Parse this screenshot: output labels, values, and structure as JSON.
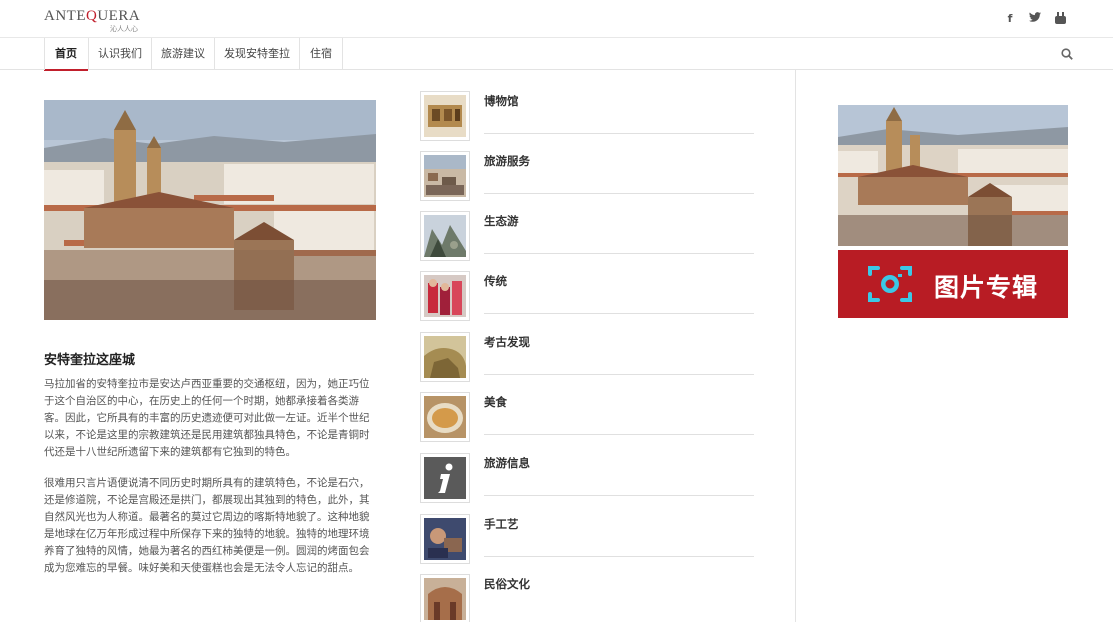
{
  "header": {
    "logo_main_a": "ANTE",
    "logo_main_q": "Q",
    "logo_main_b": "UERA",
    "logo_sub": "沁人人心",
    "social": [
      {
        "icon": "facebook-icon",
        "glyph": "f"
      },
      {
        "icon": "twitter-icon",
        "glyph": "t"
      },
      {
        "icon": "youtube-icon",
        "glyph": "▶"
      }
    ]
  },
  "nav": {
    "items": [
      {
        "label": "首页",
        "active": true
      },
      {
        "label": "认识我们"
      },
      {
        "label": "旅游建议"
      },
      {
        "label": "发现安特奎拉"
      },
      {
        "label": "住宿"
      }
    ]
  },
  "article": {
    "title": "安特奎拉这座城",
    "paragraph1": "马拉加省的安特奎拉市是安达卢西亚重要的交通枢纽，因为，她正巧位于这个自治区的中心，在历史上的任何一个时期，她都承接着各类游客。因此，它所具有的丰富的历史遗迹便可对此做一左证。近半个世纪以来，不论是这里的宗教建筑还是民用建筑都独具特色，不论是青铜时代还是十八世纪所遗留下来的建筑都有它独到的特色。",
    "paragraph2": "很难用只言片语便说清不同历史时期所具有的建筑特色，不论是石穴，还是修道院，不论是宫殿还是拱门，都展现出其独到的特色，此外，其自然风光也为人称道。最著名的莫过它周边的喀斯特地貌了。这种地貌是地球在亿万年形成过程中所保存下来的独特的地貌。独特的地理环境养育了独特的风情，她最为著名的西红柿美便是一例。圆润的烤面包会成为您难忘的早餐。味好美和天使蛋糕也会是无法令人忘记的甜点。"
  },
  "categories": [
    {
      "label": "博物馆",
      "thumb": "museum"
    },
    {
      "label": "旅游服务",
      "thumb": "town"
    },
    {
      "label": "生态游",
      "thumb": "mountain"
    },
    {
      "label": "传统",
      "thumb": "festival"
    },
    {
      "label": "考古发现",
      "thumb": "rock"
    },
    {
      "label": "美食",
      "thumb": "soup"
    },
    {
      "label": "旅游信息",
      "thumb": "info"
    },
    {
      "label": "手工艺",
      "thumb": "craft"
    },
    {
      "label": "民俗文化",
      "thumb": "church"
    }
  ],
  "sidebar": {
    "album_label": "图片专辑",
    "album_icon": "camera-icon"
  },
  "colors": {
    "accent": "#c11f2c",
    "album_bg": "#b81c24",
    "camera_cyan": "#3cc8e6"
  }
}
